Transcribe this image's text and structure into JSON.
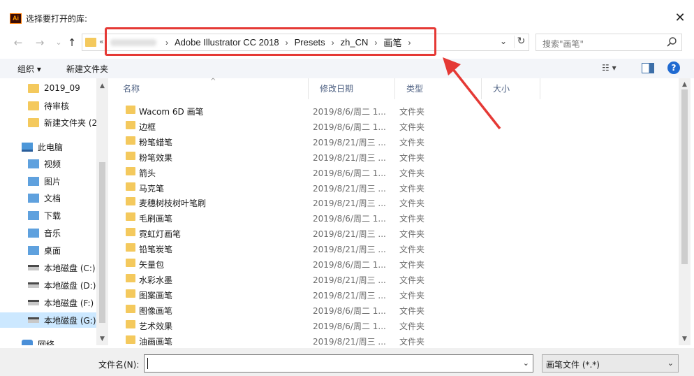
{
  "window": {
    "app_icon_text": "Ai",
    "title": "选择要打开的库:",
    "close_glyph": "✕"
  },
  "nav": {
    "back_glyph": "←",
    "forward_glyph": "→",
    "history_glyph": "⌄",
    "up_glyph": "↑",
    "address_prefix": "«",
    "breadcrumbs": [
      "Adobe Illustrator CC 2018",
      "Presets",
      "zh_CN",
      "画笔"
    ],
    "separator": "›",
    "dropdown_glyph": "⌄",
    "refresh_glyph": "↻",
    "search_placeholder": "搜索\"画笔\""
  },
  "toolbar": {
    "organize": "组织 ▾",
    "new_folder": "新建文件夹",
    "view_glyph": "☷ ▾",
    "help": "?"
  },
  "sidebar": {
    "items": [
      {
        "label": "2019_09",
        "icon": "folder-icon"
      },
      {
        "label": "待审核",
        "icon": "folder-icon"
      },
      {
        "label": "新建文件夹 (2",
        "icon": "folder-icon"
      },
      {
        "label": "此电脑",
        "icon": "computer-icon"
      },
      {
        "label": "视频",
        "icon": "video-icon"
      },
      {
        "label": "图片",
        "icon": "pictures-icon"
      },
      {
        "label": "文档",
        "icon": "documents-icon"
      },
      {
        "label": "下载",
        "icon": "download-icon"
      },
      {
        "label": "音乐",
        "icon": "music-icon"
      },
      {
        "label": "桌面",
        "icon": "desktop-icon"
      },
      {
        "label": "本地磁盘 (C:)",
        "icon": "drive-icon"
      },
      {
        "label": "本地磁盘 (D:)",
        "icon": "drive-icon"
      },
      {
        "label": "本地磁盘 (F:)",
        "icon": "drive-icon"
      },
      {
        "label": "本地磁盘 (G:)",
        "icon": "drive-icon",
        "selected": true
      },
      {
        "label": "网络",
        "icon": "network-icon"
      }
    ]
  },
  "columns": {
    "name": "名称",
    "modified": "修改日期",
    "type": "类型",
    "size": "大小",
    "sort_glyph": "^"
  },
  "files": [
    {
      "name": "Wacom 6D 画笔",
      "date": "2019/8/6/周二 1...",
      "type": "文件夹"
    },
    {
      "name": "边框",
      "date": "2019/8/6/周二 1...",
      "type": "文件夹"
    },
    {
      "name": "粉笔蜡笔",
      "date": "2019/8/21/周三 ...",
      "type": "文件夹"
    },
    {
      "name": "粉笔效果",
      "date": "2019/8/21/周三 ...",
      "type": "文件夹"
    },
    {
      "name": "箭头",
      "date": "2019/8/6/周二 1...",
      "type": "文件夹"
    },
    {
      "name": "马克笔",
      "date": "2019/8/21/周三 ...",
      "type": "文件夹"
    },
    {
      "name": "麦穗树枝树叶笔刷",
      "date": "2019/8/21/周三 ...",
      "type": "文件夹"
    },
    {
      "name": "毛刷画笔",
      "date": "2019/8/6/周二 1...",
      "type": "文件夹"
    },
    {
      "name": "霓虹灯画笔",
      "date": "2019/8/21/周三 ...",
      "type": "文件夹"
    },
    {
      "name": "铅笔炭笔",
      "date": "2019/8/21/周三 ...",
      "type": "文件夹"
    },
    {
      "name": "矢量包",
      "date": "2019/8/6/周二 1...",
      "type": "文件夹"
    },
    {
      "name": "水彩水墨",
      "date": "2019/8/21/周三 ...",
      "type": "文件夹"
    },
    {
      "name": "图案画笔",
      "date": "2019/8/21/周三 ...",
      "type": "文件夹"
    },
    {
      "name": "图像画笔",
      "date": "2019/8/6/周二 1...",
      "type": "文件夹"
    },
    {
      "name": "艺术效果",
      "date": "2019/8/6/周二 1...",
      "type": "文件夹"
    },
    {
      "name": "油画画笔",
      "date": "2019/8/21/周三 ...",
      "type": "文件夹"
    }
  ],
  "bottom": {
    "filename_label": "文件名(N):",
    "filename_value": "",
    "filename_dd_glyph": "⌄",
    "filetype_value": "画笔文件 (*.*)",
    "filetype_dd_glyph": "⌄"
  },
  "colors": {
    "highlight": "#e53935",
    "selection": "#cce8ff",
    "folder": "#f4c95d"
  }
}
